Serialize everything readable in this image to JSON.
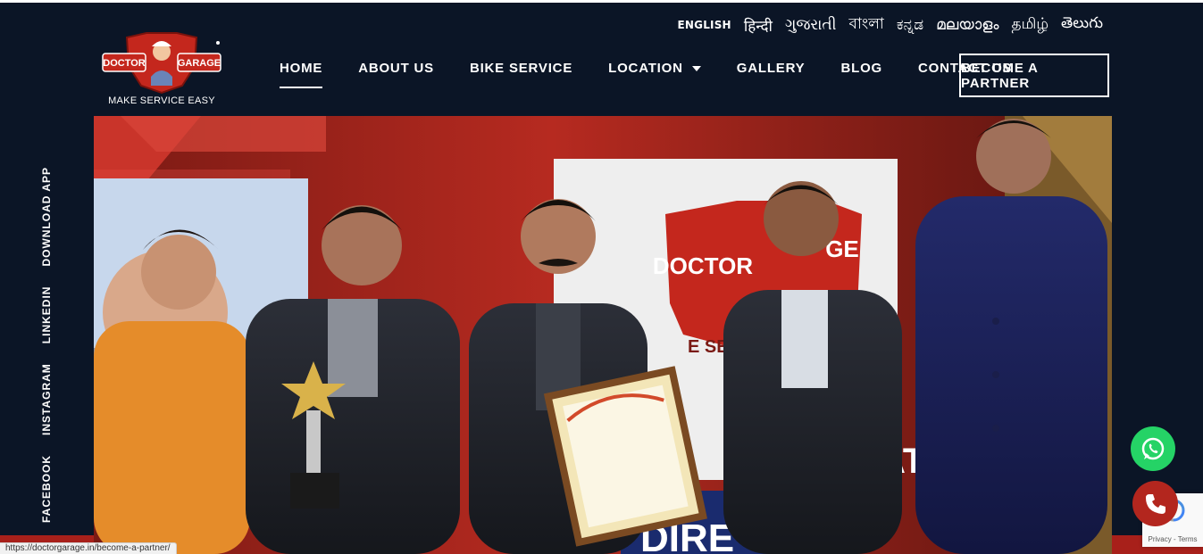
{
  "languages": [
    "ENGLISH",
    "हिन्दी",
    "ગુજરાતી",
    "বাংলা",
    "ಕನ್ನಡ",
    "മലയാളം",
    "தமிழ்",
    "తెలుగు"
  ],
  "logo": {
    "left_word": "DOCTOR",
    "right_word": "GARAGE",
    "tagline": "MAKE SERVICE EASY"
  },
  "nav": {
    "items": [
      "HOME",
      "ABOUT US",
      "BIKE SERVICE",
      "LOCATION",
      "GALLERY",
      "BLOG",
      "CONTACT US"
    ],
    "active": "HOME",
    "partner_button": "BECOME A PARTNER"
  },
  "social": [
    "FACEBOOK",
    "INSTAGRAM",
    "LINKEDIN",
    "DOWNLOAD APP"
  ],
  "hero": {
    "backdrop_logo_left": "DOCTOR",
    "backdrop_logo_right": "GE",
    "backdrop_sub": "E SERV",
    "backdrop_bottom": "DIRE",
    "backdrop_side": "ATI"
  },
  "status_url": "https://doctorgarage.in/become-a-partner/",
  "recaptcha": {
    "text": "Privacy - Terms"
  },
  "colors": {
    "background": "#0b1526",
    "brand_red": "#b3261e",
    "whatsapp": "#25d366"
  },
  "icons": [
    "whatsapp-icon",
    "phone-icon",
    "recaptcha-icon",
    "chevron-down-icon"
  ]
}
